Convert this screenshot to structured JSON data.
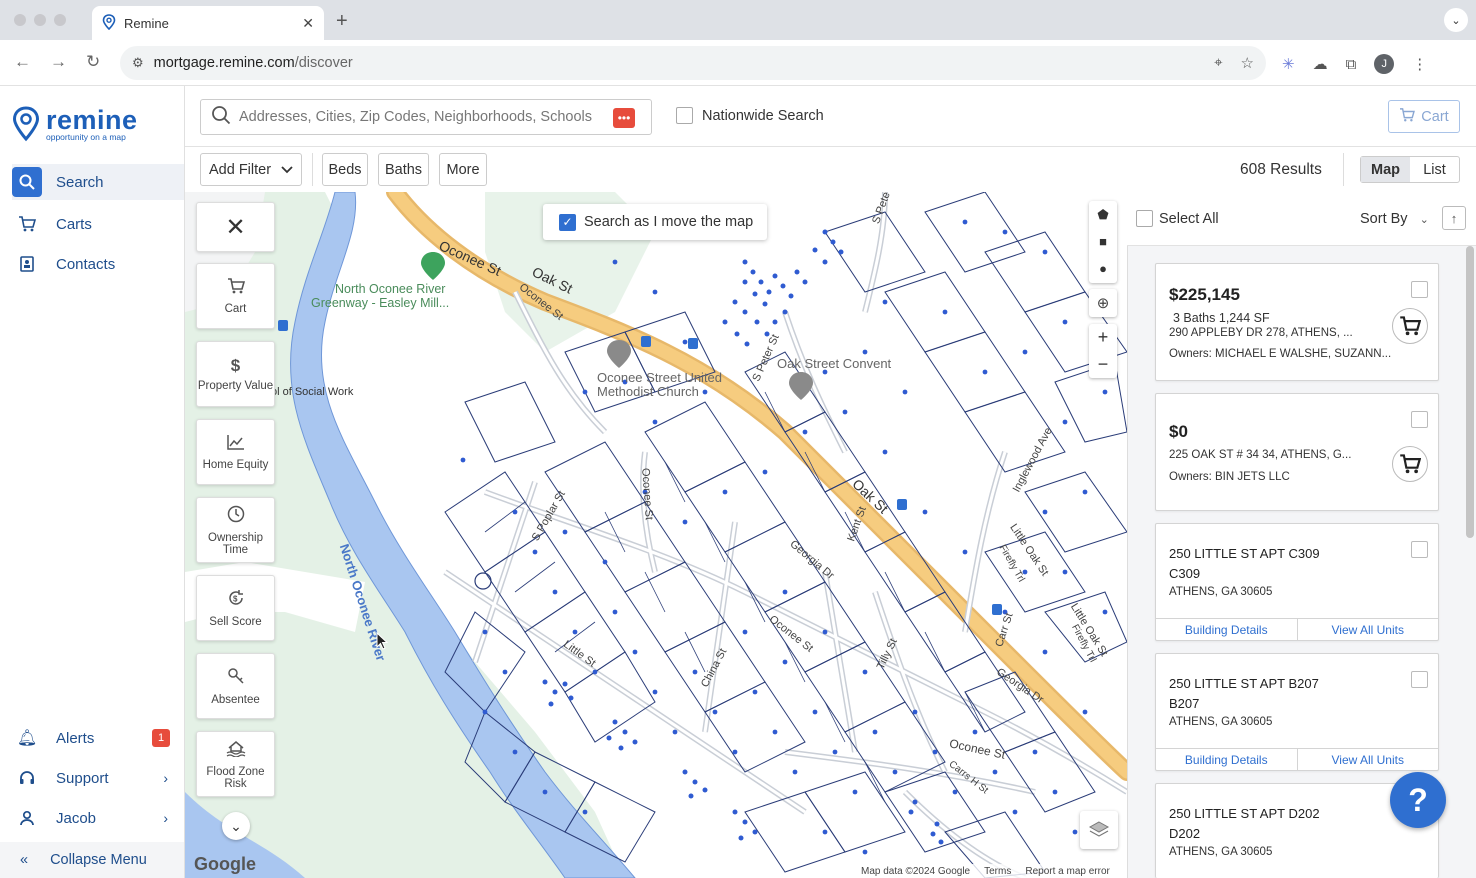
{
  "browser": {
    "tab_title": "Remine",
    "url_host": "mortgage.remine.com",
    "url_path": "/discover",
    "profile_initial": "J"
  },
  "sidebar": {
    "brand": "remine",
    "tagline": "opportunity on a map",
    "items": [
      {
        "label": "Search",
        "icon": "search-icon"
      },
      {
        "label": "Carts",
        "icon": "cart-icon"
      },
      {
        "label": "Contacts",
        "icon": "contacts-icon"
      }
    ],
    "bottom": [
      {
        "label": "Alerts",
        "icon": "bell-icon",
        "badge": "1"
      },
      {
        "label": "Support",
        "icon": "headset-icon"
      },
      {
        "label": "Jacob",
        "icon": "user-icon"
      }
    ],
    "collapse_label": "Collapse Menu"
  },
  "search": {
    "placeholder": "Addresses, Cities, Zip Codes, Neighborhoods, Schools",
    "nationwide_label": "Nationwide Search",
    "cart_label": "Cart"
  },
  "filters": {
    "add_filter": "Add Filter",
    "beds": "Beds",
    "baths": "Baths",
    "more": "More",
    "results": "608 Results",
    "view_map": "Map",
    "view_list": "List"
  },
  "map": {
    "search_as_move": "Search as I move the map",
    "tools": [
      {
        "label": "Cart",
        "icon": "cart-icon"
      },
      {
        "label": "Property Value",
        "icon": "dollar-icon"
      },
      {
        "label": "Home Equity",
        "icon": "chart-icon"
      },
      {
        "label": "Ownership Time",
        "icon": "clock-icon"
      },
      {
        "label": "Sell Score",
        "icon": "sell-score-icon"
      },
      {
        "label": "Absentee",
        "icon": "key-icon"
      },
      {
        "label": "Flood Zone Risk",
        "icon": "flood-icon"
      }
    ],
    "labels": {
      "oconee_st": "Oconee St",
      "oak_st_top": "Oak St",
      "oak_st": "Oak St",
      "oconee_st_small": "Oconee St",
      "north_oconee_river": "North Oconee River",
      "greenway": "North Oconee River",
      "greenway2": "Greenway - Easley Mill...",
      "school": "ol of Social Work",
      "church1": "Oconee Street United",
      "church2": "Methodist Church",
      "convent": "Oak Street Convent",
      "s_peter": "S Peter St",
      "s_poplar": "S Poplar St",
      "oconee_v": "Oconee St",
      "georgia_dr": "Georgia Dr",
      "kent_st": "Kent St",
      "little_st": "Little St",
      "china_st": "China St",
      "oconee_st2": "Oconee St",
      "tilly_st": "Tilly St",
      "carr_st": "Carr St",
      "georgia_dr2": "Georgia Dr",
      "oconee_st3": "Oconee St",
      "carrs_hill": "Carrs H St",
      "inglewood": "Inglewood Ave",
      "little_oak": "Little Oak St",
      "firefly": "Firefly Trl",
      "little_oak2": "Little Oak St",
      "firefly2": "Firefly Trl",
      "s_pete": "S Pete"
    },
    "google": "Google",
    "attribution": {
      "data": "Map data ©2024 Google",
      "terms": "Terms",
      "report": "Report a map error"
    }
  },
  "panel": {
    "select_all": "Select All",
    "sort_by": "Sort By",
    "cards": [
      {
        "price": "$225,145",
        "details": "3 Baths 1,244 SF",
        "address": "290 APPLEBY DR 278, ATHENS, ...",
        "owners": "Owners: MICHAEL E WALSHE, SUZANN..."
      },
      {
        "price": "$0",
        "address": "225 OAK ST # 34 34, ATHENS, G...",
        "owners": "Owners: BIN JETS LLC"
      },
      {
        "address": "250 LITTLE ST APT C309",
        "unit": "C309",
        "city": "ATHENS, GA 30605",
        "building_details": "Building Details",
        "view_units": "View All Units"
      },
      {
        "address": "250 LITTLE ST APT B207",
        "unit": "B207",
        "city": "ATHENS, GA 30605",
        "building_details": "Building Details",
        "view_units": "View All Units"
      },
      {
        "address": "250 LITTLE ST APT D202",
        "unit": "D202",
        "city": "ATHENS, GA 30605"
      }
    ],
    "help": "?"
  }
}
